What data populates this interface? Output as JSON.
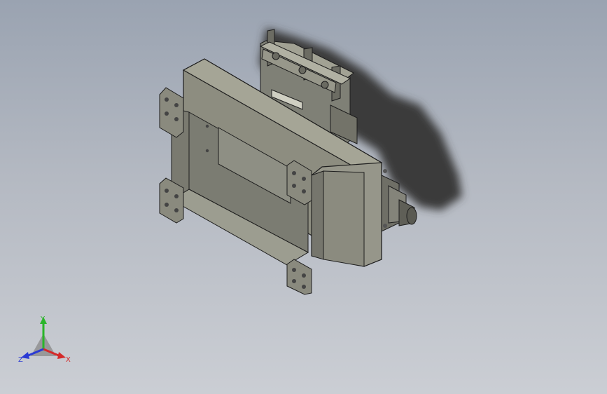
{
  "viewport": {
    "background_top": "#9aa3b1",
    "background_bottom": "#cbced4"
  },
  "model": {
    "shaded_color": "#8d8d80",
    "edge_color": "#1d1d1d",
    "shadow_color": "#3a3a3a"
  },
  "triad": {
    "x_label": "X",
    "y_label": "Y",
    "z_label": "Z",
    "x_color": "#d42a2a",
    "y_color": "#2ab52a",
    "z_color": "#2a3ad4"
  }
}
